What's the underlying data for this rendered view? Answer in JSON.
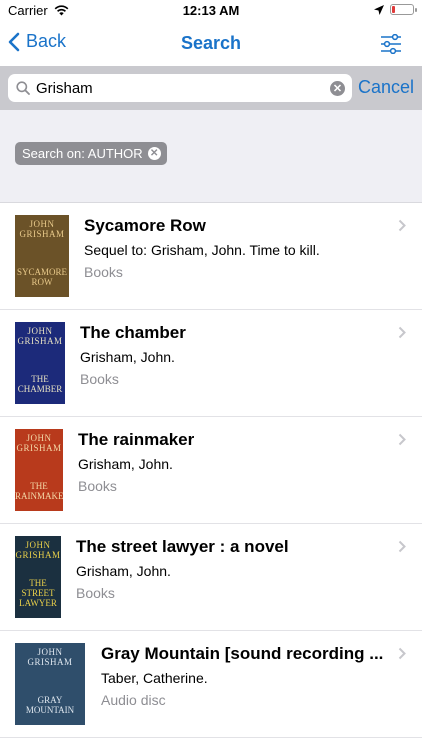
{
  "status": {
    "carrier": "Carrier",
    "time": "12:13 AM",
    "battery_level": 0.15
  },
  "navbar": {
    "back_label": "Back",
    "title": "Search"
  },
  "search": {
    "value": "Grisham",
    "cancel_label": "Cancel"
  },
  "filter_chip": {
    "label": "Search on: AUTHOR"
  },
  "results": [
    {
      "title": "Sycamore Row",
      "subtitle": "Sequel to: Grisham, John. Time to kill.",
      "format": "Books",
      "cover": {
        "author": "JOHN GRISHAM",
        "title": "SYCAMORE ROW",
        "bg": "#6b5228",
        "fg": "#e8c98a"
      }
    },
    {
      "title": "The chamber",
      "subtitle": "Grisham, John.",
      "format": "Books",
      "cover": {
        "author": "JOHN GRISHAM",
        "title": "THE CHAMBER",
        "bg": "#1c2a7a",
        "fg": "#e6e0c2"
      }
    },
    {
      "title": "The rainmaker",
      "subtitle": "Grisham, John.",
      "format": "Books",
      "cover": {
        "author": "JOHN GRISHAM",
        "title": "THE RAINMAKER",
        "bg": "#b83a1c",
        "fg": "#f3d8a8"
      }
    },
    {
      "title": "The street lawyer : a novel",
      "subtitle": "Grisham, John.",
      "format": "Books",
      "cover": {
        "author": "JOHN GRISHAM",
        "title": "THE STREET LAWYER",
        "bg": "#1b3040",
        "fg": "#e8cf4a"
      }
    },
    {
      "title": "Gray Mountain [sound recording ...",
      "subtitle": "Taber, Catherine.",
      "format": "Audio disc",
      "cover": {
        "author": "JOHN GRISHAM",
        "title": "GRAY MOUNTAIN",
        "bg": "#2f4e6b",
        "fg": "#dfe7ef"
      }
    }
  ],
  "colors": {
    "accent": "#1a73c9",
    "chip_bg": "#8e8e93",
    "secondary_text": "#8e8e93"
  }
}
